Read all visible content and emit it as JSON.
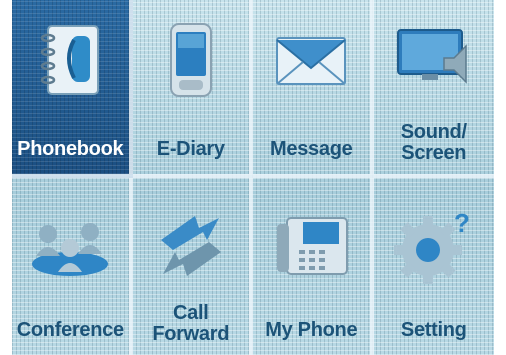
{
  "menu": {
    "items": [
      {
        "label": "Phonebook",
        "icon": "phonebook-icon",
        "selected": true
      },
      {
        "label": "E-Diary",
        "icon": "diary-icon",
        "selected": false
      },
      {
        "label": "Message",
        "icon": "envelope-icon",
        "selected": false
      },
      {
        "label": "Sound/\nScreen",
        "icon": "sound-screen-icon",
        "selected": false
      },
      {
        "label": "Conference",
        "icon": "conference-icon",
        "selected": false
      },
      {
        "label": "Call\nForward",
        "icon": "call-forward-icon",
        "selected": false
      },
      {
        "label": "My Phone",
        "icon": "desk-phone-icon",
        "selected": false
      },
      {
        "label": "Setting",
        "icon": "gear-icon",
        "selected": false
      }
    ]
  },
  "colors": {
    "selected_bg": "#1f5a8f",
    "label_text": "#1c5378",
    "screen_bg": "#a9cfdc"
  }
}
